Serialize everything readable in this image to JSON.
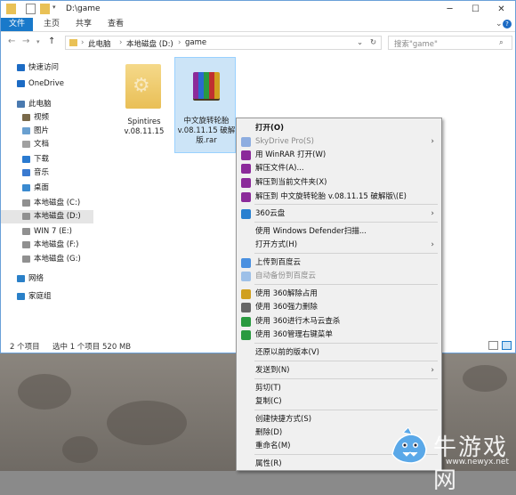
{
  "window": {
    "title": "D:\\game"
  },
  "ribbon": {
    "tabs": [
      "文件",
      "主页",
      "共享",
      "查看"
    ]
  },
  "address": {
    "crumbs": [
      "此电脑",
      "本地磁盘 (D:)",
      "game"
    ]
  },
  "search": {
    "placeholder": "搜索\"game\""
  },
  "sidebar": {
    "items": [
      {
        "label": "快速访问",
        "icon": "star-icon"
      },
      {
        "label": "OneDrive",
        "icon": "cloud-icon"
      },
      {
        "label": "此电脑",
        "icon": "computer-icon"
      },
      {
        "label": "视频",
        "icon": "video-folder-icon"
      },
      {
        "label": "图片",
        "icon": "pictures-folder-icon"
      },
      {
        "label": "文档",
        "icon": "documents-folder-icon"
      },
      {
        "label": "下载",
        "icon": "downloads-icon"
      },
      {
        "label": "音乐",
        "icon": "music-icon"
      },
      {
        "label": "桌面",
        "icon": "desktop-folder-icon"
      },
      {
        "label": "本地磁盘 (C:)",
        "icon": "drive-icon"
      },
      {
        "label": "本地磁盘 (D:)",
        "icon": "drive-icon"
      },
      {
        "label": "WIN 7 (E:)",
        "icon": "drive-icon"
      },
      {
        "label": "本地磁盘 (F:)",
        "icon": "drive-icon"
      },
      {
        "label": "本地磁盘 (G:)",
        "icon": "drive-icon"
      },
      {
        "label": "网络",
        "icon": "network-icon"
      },
      {
        "label": "家庭组",
        "icon": "homegroup-icon"
      }
    ]
  },
  "files": [
    {
      "name": "Spintires v.08.11.15",
      "icon": "folder-icon"
    },
    {
      "name": "中文旋转轮胎 v.08.11.15 破解版.rar",
      "icon": "winrar-archive-icon"
    }
  ],
  "status": {
    "count": "2 个项目",
    "selected": "选中 1 个项目  520 MB"
  },
  "context_menu": {
    "items": [
      {
        "label": "打开(O)",
        "bold": true,
        "icon": ""
      },
      {
        "label": "SkyDrive Pro(S)",
        "disabled": true,
        "submenu": true,
        "icon": "skydrive-icon"
      },
      {
        "label": "用 WinRAR 打开(W)",
        "icon": "winrar-icon"
      },
      {
        "label": "解压文件(A)...",
        "icon": "winrar-icon"
      },
      {
        "label": "解压到当前文件夹(X)",
        "icon": "winrar-icon"
      },
      {
        "label": "解压到 中文旋转轮胎 v.08.11.15 破解版\\(E)",
        "icon": "winrar-icon"
      },
      {
        "label": "360云盘",
        "submenu": true,
        "icon": "360-cloud-icon"
      },
      {
        "label": "使用 Windows Defender扫描...",
        "icon": ""
      },
      {
        "label": "打开方式(H)",
        "submenu": true,
        "icon": ""
      },
      {
        "label": "上传到百度云",
        "icon": "baidu-cloud-icon"
      },
      {
        "label": "自动备份到百度云",
        "disabled": true,
        "icon": "baidu-cloud-icon"
      },
      {
        "label": "使用 360解除占用",
        "icon": "360-unlock-icon"
      },
      {
        "label": "使用 360强力删除",
        "icon": "360-delete-icon"
      },
      {
        "label": "使用 360进行木马云查杀",
        "icon": "360-scan-icon"
      },
      {
        "label": "使用 360管理右键菜单",
        "icon": "360-menu-icon"
      },
      {
        "label": "还原以前的版本(V)",
        "icon": ""
      },
      {
        "label": "发送到(N)",
        "submenu": true,
        "icon": ""
      },
      {
        "label": "剪切(T)",
        "icon": ""
      },
      {
        "label": "复制(C)",
        "icon": ""
      },
      {
        "label": "创建快捷方式(S)",
        "icon": ""
      },
      {
        "label": "删除(D)",
        "icon": ""
      },
      {
        "label": "重命名(M)",
        "icon": ""
      },
      {
        "label": "属性(R)",
        "icon": ""
      }
    ]
  },
  "watermark": {
    "brand": "牛游戏网",
    "url": "www.newyx.net"
  },
  "colors": {
    "accent": "#1979ca",
    "selection": "#cce4f7"
  }
}
